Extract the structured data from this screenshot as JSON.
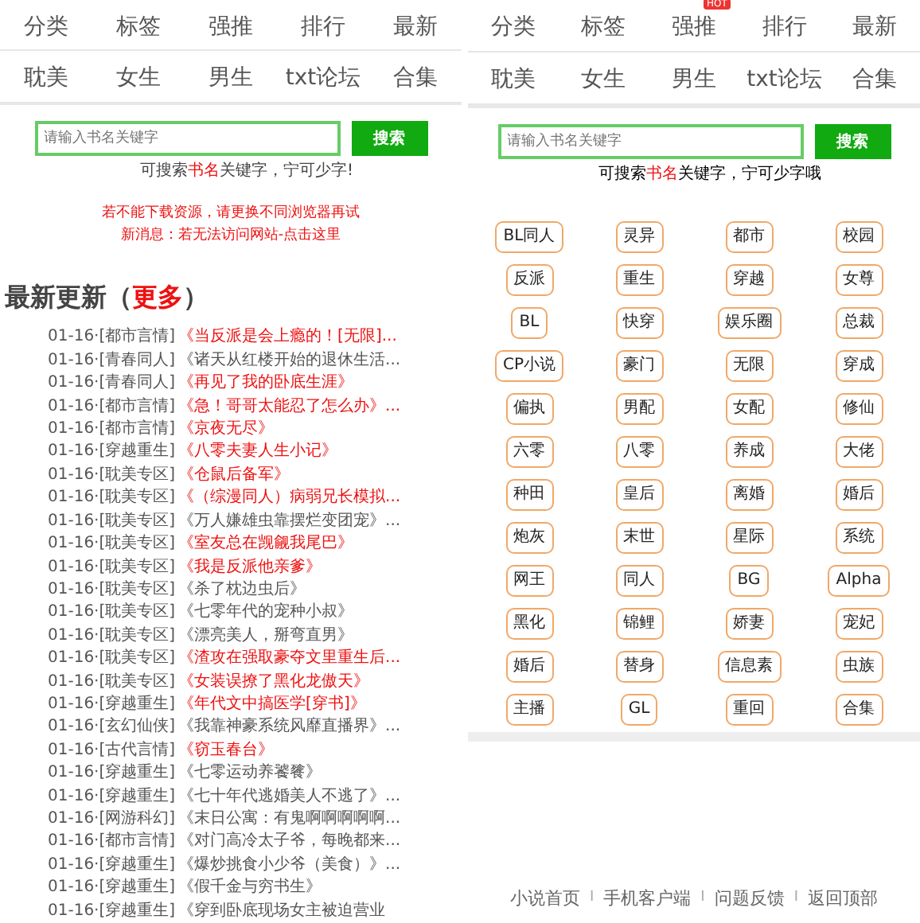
{
  "left_page": {
    "nav": [
      [
        {
          "label": "分类"
        },
        {
          "label": "标签"
        },
        {
          "label": "强推"
        },
        {
          "label": "排行"
        },
        {
          "label": "最新"
        }
      ],
      [
        {
          "label": "耽美"
        },
        {
          "label": "女生"
        },
        {
          "label": "男生"
        },
        {
          "label": "txt论坛"
        },
        {
          "label": "合集"
        }
      ]
    ],
    "search": {
      "placeholder": "请输入书名关键字",
      "button": "搜索"
    },
    "hint": [
      {
        "text": "可搜索",
        "highlight": false
      },
      {
        "text": "书名",
        "highlight": true
      },
      {
        "text": "关键字，宁可少字!",
        "highlight": false
      }
    ],
    "notices": [
      "若不能下载资源，请更换不同浏览器再试",
      "新消息：若无法访问网站-点击这里"
    ],
    "latest": {
      "title": "最新更新（",
      "more": "更多",
      "close": "）"
    },
    "rows": [
      {
        "prefix": "01-16·[都市言情]",
        "title": "《当反派是会上瘾的！[无限]...",
        "highlighted": true
      },
      {
        "prefix": "01-16·[青春同人]",
        "title": "《诸天从红楼开始的退休生活...",
        "highlighted": false
      },
      {
        "prefix": "01-16·[青春同人]",
        "title": "《再见了我的卧底生涯》",
        "highlighted": true
      },
      {
        "prefix": "01-16·[都市言情]",
        "title": "《急！哥哥太能忍了怎么办》...",
        "highlighted": true
      },
      {
        "prefix": "01-16·[都市言情]",
        "title": "《京夜无尽》",
        "highlighted": true
      },
      {
        "prefix": "01-16·[穿越重生]",
        "title": "《八零夫妻人生小记》",
        "highlighted": true
      },
      {
        "prefix": "01-16·[耽美专区]",
        "title": "《仓鼠后备军》",
        "highlighted": true
      },
      {
        "prefix": "01-16·[耽美专区]",
        "title": "《（综漫同人）病弱兄长模拟...",
        "highlighted": true
      },
      {
        "prefix": "01-16·[耽美专区]",
        "title": "《万人嫌雄虫靠摆烂变团宠》...",
        "highlighted": false
      },
      {
        "prefix": "01-16·[耽美专区]",
        "title": "《室友总在觊觎我尾巴》",
        "highlighted": true
      },
      {
        "prefix": "01-16·[耽美专区]",
        "title": "《我是反派他亲爹》",
        "highlighted": true
      },
      {
        "prefix": "01-16·[耽美专区]",
        "title": "《杀了枕边虫后》",
        "highlighted": false
      },
      {
        "prefix": "01-16·[耽美专区]",
        "title": "《七零年代的宠种小叔》",
        "highlighted": false
      },
      {
        "prefix": "01-16·[耽美专区]",
        "title": "《漂亮美人，掰弯直男》",
        "highlighted": false
      },
      {
        "prefix": "01-16·[耽美专区]",
        "title": "《渣攻在强取豪夺文里重生后...",
        "highlighted": true
      },
      {
        "prefix": "01-16·[耽美专区]",
        "title": "《女装误撩了黑化龙傲天》",
        "highlighted": true
      },
      {
        "prefix": "01-16·[穿越重生]",
        "title": "《年代文中搞医学[穿书]》",
        "highlighted": true
      },
      {
        "prefix": "01-16·[玄幻仙侠]",
        "title": "《我靠神豪系统风靡直播界》...",
        "highlighted": false
      },
      {
        "prefix": "01-16·[古代言情]",
        "title": "《窃玉春台》",
        "highlighted": true
      },
      {
        "prefix": "01-16·[穿越重生]",
        "title": "《七零运动养饕餮》",
        "highlighted": false
      },
      {
        "prefix": "01-16·[穿越重生]",
        "title": "《七十年代逃婚美人不逃了》...",
        "highlighted": false
      },
      {
        "prefix": "01-16·[网游科幻]",
        "title": "《末日公寓：有鬼啊啊啊啊啊...",
        "highlighted": false
      },
      {
        "prefix": "01-16·[都市言情]",
        "title": "《对门高冷太子爷，每晚都来...",
        "highlighted": false
      },
      {
        "prefix": "01-16·[穿越重生]",
        "title": "《爆炒挑食小少爷（美食）》...",
        "highlighted": false
      },
      {
        "prefix": "01-16·[穿越重生]",
        "title": "《假千金与穷书生》",
        "highlighted": false
      },
      {
        "prefix": "01-16·[穿越重生]",
        "title": "《穿到卧底现场女主被迫营业",
        "highlighted": false
      }
    ]
  },
  "right_page": {
    "nav": [
      [
        {
          "label": "分类"
        },
        {
          "label": "标签"
        },
        {
          "label": "强推",
          "badge": "HOT"
        },
        {
          "label": "排行"
        },
        {
          "label": "最新"
        }
      ],
      [
        {
          "label": "耽美"
        },
        {
          "label": "女生"
        },
        {
          "label": "男生"
        },
        {
          "label": "txt论坛"
        },
        {
          "label": "合集"
        }
      ]
    ],
    "search": {
      "placeholder": "请输入书名关键字",
      "button": "搜索"
    },
    "hint": [
      {
        "text": "可搜索",
        "highlight": false
      },
      {
        "text": "书名",
        "highlight": true
      },
      {
        "text": "关键字，宁可少字哦",
        "highlight": false
      }
    ],
    "tags": [
      "BL同人",
      "灵异",
      "都市",
      "校园",
      "反派",
      "重生",
      "穿越",
      "女尊",
      "BL",
      "快穿",
      "娱乐圈",
      "总裁",
      "CP小说",
      "豪门",
      "无限",
      "穿成",
      "偏执",
      "男配",
      "女配",
      "修仙",
      "六零",
      "八零",
      "养成",
      "大佬",
      "种田",
      "皇后",
      "离婚",
      "婚后",
      "炮灰",
      "末世",
      "星际",
      "系统",
      "网王",
      "同人",
      "BG",
      "Alpha",
      "黑化",
      "锦鲤",
      "娇妻",
      "宠妃",
      "婚后",
      "替身",
      "信息素",
      "虫族",
      "主播",
      "GL",
      "重回",
      "合集"
    ],
    "footer": {
      "links": [
        "小说首页",
        "手机客户端",
        "问题反馈",
        "返回顶部"
      ],
      "separators": [
        "I",
        "I",
        "I"
      ]
    }
  }
}
